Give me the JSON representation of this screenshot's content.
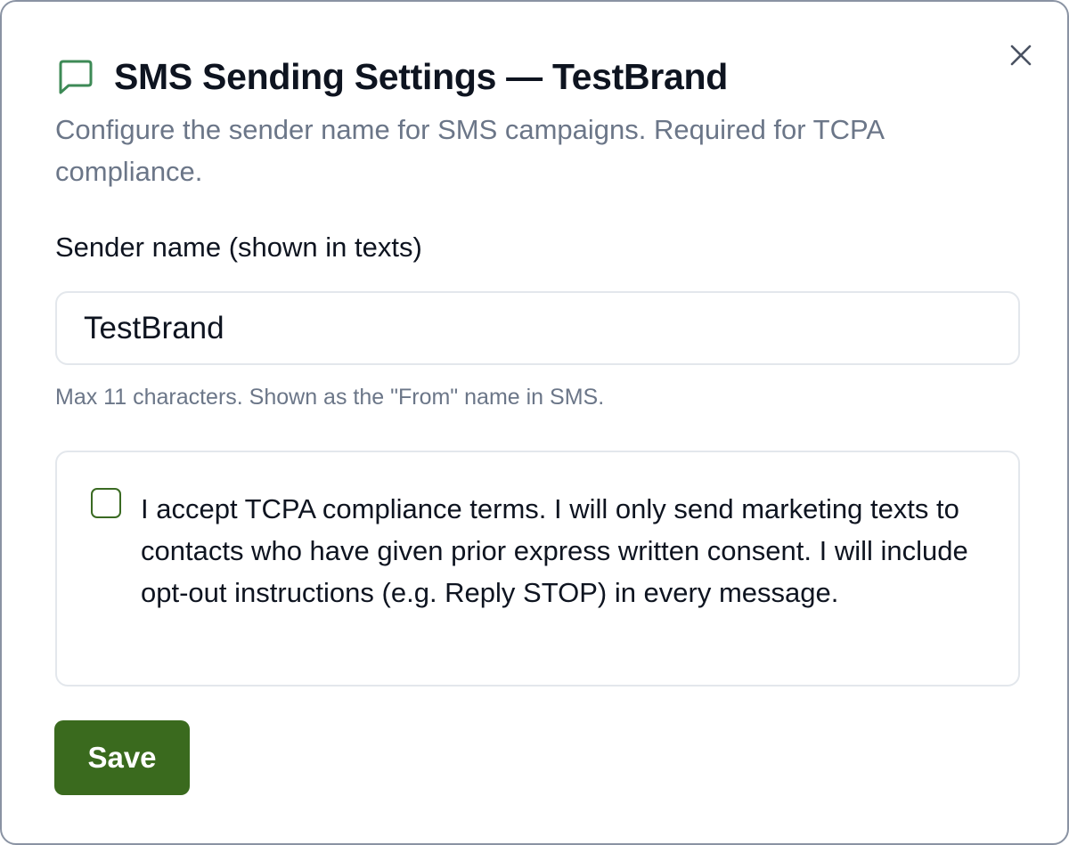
{
  "dialog": {
    "title": "SMS Sending Settings — TestBrand",
    "title_icon": "message-square-icon",
    "subtitle": "Configure the sender name for SMS campaigns. Required for TCPA compliance.",
    "close_icon": "close-icon"
  },
  "sender": {
    "label": "Sender name (shown in texts)",
    "value": "TestBrand",
    "hint": "Max 11 characters. Shown as the \"From\" name in SMS."
  },
  "consent": {
    "checked": false,
    "text": "I accept TCPA compliance terms. I will only send marketing texts to contacts who have given prior express written consent. I will include opt-out instructions (e.g. Reply STOP) in every message."
  },
  "actions": {
    "save_label": "Save"
  },
  "colors": {
    "accent": "#3a6a1e",
    "title_icon": "#3d8a56",
    "muted_text": "#6b7688",
    "border": "#e3e7ec"
  }
}
